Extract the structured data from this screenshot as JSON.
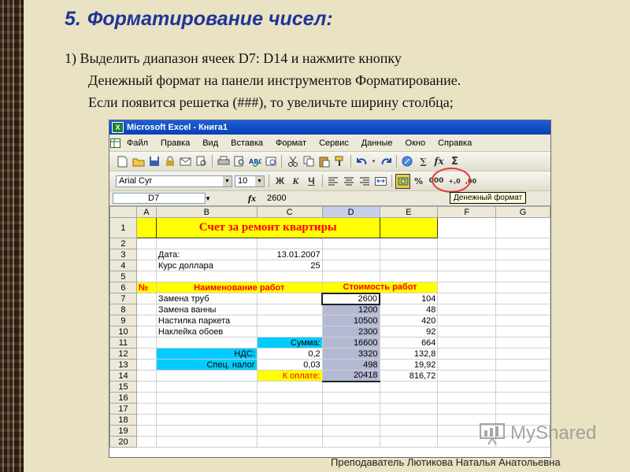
{
  "slide": {
    "title_number": "5.",
    "title": "Форматирование чисел:",
    "paragraph_line1": "1) Выделить диапазон ячеек D7: D14 и нажмите кнопку",
    "paragraph_line2": "Денежный формат на панели инструментов Форматирование.",
    "paragraph_line3": "Если появится решетка (###), то увеличьте ширину столбца;",
    "footer": "Преподаватель Лютикова Наталья Анатольевна",
    "watermark": "MyShared"
  },
  "excel": {
    "window_title": "Microsoft Excel - Книга1",
    "menu": [
      "Файл",
      "Правка",
      "Вид",
      "Вставка",
      "Формат",
      "Сервис",
      "Данные",
      "Окно",
      "Справка"
    ],
    "font_name": "Arial Cyr",
    "font_size": "10",
    "bold_label": "Ж",
    "italic_label": "К",
    "underline_label": "Ч",
    "percent_label": "%",
    "thousands_label": "000",
    "tooltip": "Денежный формат",
    "name_box": "D7",
    "fx_label": "fx",
    "formula_value": "2600",
    "columns": [
      "A",
      "B",
      "C",
      "D",
      "E",
      "F",
      "G"
    ],
    "rows": {
      "r1": {
        "num": "1",
        "title": "Счет за ремонт квартиры"
      },
      "r2": {
        "num": "2"
      },
      "r3": {
        "num": "3",
        "b": "Дата:",
        "c": "13.01.2007"
      },
      "r4": {
        "num": "4",
        "b": "Курс доллара",
        "c": "25"
      },
      "r5": {
        "num": "5"
      },
      "r6": {
        "num": "6",
        "a": "№",
        "b": "Наименование работ",
        "d": "Стоимость работ"
      },
      "r7": {
        "num": "7",
        "b": "Замена труб",
        "d": "2600",
        "e": "104"
      },
      "r8": {
        "num": "8",
        "b": "Замена ванны",
        "d": "1200",
        "e": "48"
      },
      "r9": {
        "num": "9",
        "b": "Настилка паркета",
        "d": "10500",
        "e": "420"
      },
      "r10": {
        "num": "10",
        "b": "Наклейка обоев",
        "d": "2300",
        "e": "92"
      },
      "r11": {
        "num": "11",
        "c": "Сумма:",
        "d": "16600",
        "e": "664"
      },
      "r12": {
        "num": "12",
        "b": "НДС:",
        "c": "0,2",
        "d": "3320",
        "e": "132,8"
      },
      "r13": {
        "num": "13",
        "b": "Спец. налог",
        "c": "0,03",
        "d": "498",
        "e": "19,92"
      },
      "r14": {
        "num": "14",
        "c": "К оплате:",
        "d": "20418",
        "e": "816,72"
      },
      "r15": {
        "num": "15"
      },
      "r16": {
        "num": "16"
      },
      "r17": {
        "num": "17"
      },
      "r18": {
        "num": "18"
      },
      "r19": {
        "num": "19"
      },
      "r20": {
        "num": "20"
      }
    }
  }
}
